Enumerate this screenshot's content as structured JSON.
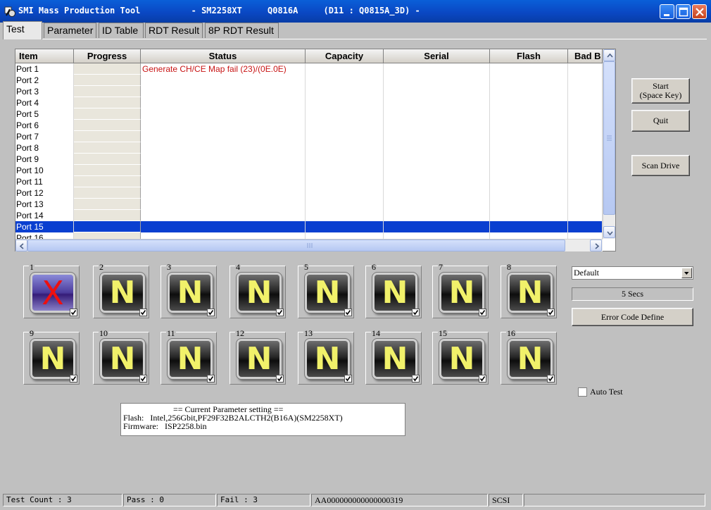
{
  "window": {
    "title": "SMI Mass Production Tool          - SM2258XT     Q0816A     (D11 : Q0815A_3D) -"
  },
  "tabs": [
    {
      "label": "Test",
      "active": true
    },
    {
      "label": "Parameter",
      "active": false
    },
    {
      "label": "ID Table",
      "active": false
    },
    {
      "label": "RDT Result",
      "active": false
    },
    {
      "label": "8P RDT Result",
      "active": false
    }
  ],
  "grid": {
    "columns": [
      "Item",
      "Progress",
      "Status",
      "Capacity",
      "Serial",
      "Flash",
      "Bad B"
    ],
    "rows": [
      {
        "item": "Port 1",
        "status": "Generate CH/CE Map fail (23)/(0E.0E)"
      },
      {
        "item": "Port 2",
        "status": ""
      },
      {
        "item": "Port 3",
        "status": ""
      },
      {
        "item": "Port 4",
        "status": ""
      },
      {
        "item": "Port 5",
        "status": ""
      },
      {
        "item": "Port 6",
        "status": ""
      },
      {
        "item": "Port 7",
        "status": ""
      },
      {
        "item": "Port 8",
        "status": ""
      },
      {
        "item": "Port 9",
        "status": ""
      },
      {
        "item": "Port 10",
        "status": ""
      },
      {
        "item": "Port 11",
        "status": ""
      },
      {
        "item": "Port 12",
        "status": ""
      },
      {
        "item": "Port 13",
        "status": ""
      },
      {
        "item": "Port 14",
        "status": ""
      },
      {
        "item": "Port 15",
        "status": "",
        "selected": true
      },
      {
        "item": "Port 16",
        "status": ""
      }
    ]
  },
  "buttons": {
    "start_line1": "Start",
    "start_line2": "(Space Key)",
    "quit": "Quit",
    "scan_drive": "Scan Drive",
    "error_code_define": "Error Code Define"
  },
  "ports": [
    {
      "num": "1",
      "letter": "X",
      "fail": true
    },
    {
      "num": "2",
      "letter": "N"
    },
    {
      "num": "3",
      "letter": "N"
    },
    {
      "num": "4",
      "letter": "N"
    },
    {
      "num": "5",
      "letter": "N"
    },
    {
      "num": "6",
      "letter": "N"
    },
    {
      "num": "7",
      "letter": "N"
    },
    {
      "num": "8",
      "letter": "N"
    },
    {
      "num": "9",
      "letter": "N"
    },
    {
      "num": "10",
      "letter": "N"
    },
    {
      "num": "11",
      "letter": "N"
    },
    {
      "num": "12",
      "letter": "N"
    },
    {
      "num": "13",
      "letter": "N"
    },
    {
      "num": "14",
      "letter": "N"
    },
    {
      "num": "15",
      "letter": "N"
    },
    {
      "num": "16",
      "letter": "N"
    }
  ],
  "preset": {
    "selected": "Default"
  },
  "timer": "5 Secs",
  "auto_test": {
    "label": "Auto Test",
    "checked": false
  },
  "parameters": {
    "title": "== Current Parameter setting ==",
    "flash": "Flash:   Intel,256Gbit,PF29F32B2ALCTH2(B16A)(SM2258XT)",
    "firmware": "Firmware:   ISP2258.bin"
  },
  "statusbar": {
    "test_count": "Test Count : 3",
    "pass": "Pass : 0",
    "fail": "Fail : 3",
    "serial": "AA000000000000000319",
    "interface": "SCSI"
  },
  "colors": {
    "titlebar": "#0a48c4",
    "status_error": "#c81414",
    "selection": "#0a3fd0",
    "tile_letter": "#f1f16a",
    "tile_fail": "#ee1010"
  }
}
